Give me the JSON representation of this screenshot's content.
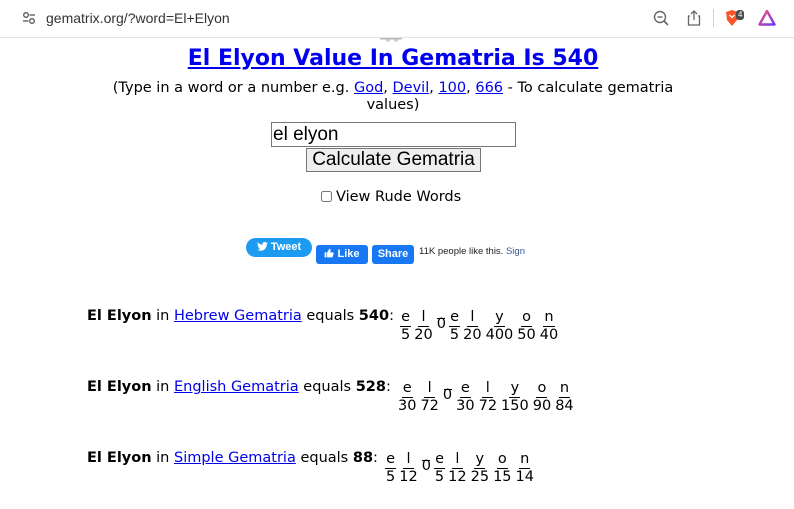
{
  "browser": {
    "url": "gematrix.org/?word=El+Elyon",
    "shield_count": "4"
  },
  "page": {
    "title": "El Elyon Value In Gematria Is 540",
    "intro": {
      "before": "(Type in a word or a number e.g. ",
      "links": [
        "God",
        "Devil",
        "100",
        "666"
      ],
      "after": " - To calculate gematria values)"
    },
    "input_value": "el elyon",
    "calculate_label": "Calculate Gematria",
    "rude_words_label": "View Rude Words",
    "rude_words_checked": false
  },
  "social": {
    "tweet_label": "Tweet",
    "like_label": "Like",
    "share_label": "Share",
    "like_count_text": "11K people like this.",
    "sign_label": "Sign"
  },
  "results": [
    {
      "word": "El Elyon",
      "in_text": "in",
      "system": "Hebrew Gematria",
      "equals_text": "equals",
      "total": "540",
      "letters": [
        {
          "ch": "e",
          "val": "5"
        },
        {
          "ch": "l",
          "val": "20"
        },
        {
          "ch": " ",
          "val": "0"
        },
        {
          "ch": "e",
          "val": "5"
        },
        {
          "ch": "l",
          "val": "20"
        },
        {
          "ch": "y",
          "val": "400"
        },
        {
          "ch": "o",
          "val": "50"
        },
        {
          "ch": "n",
          "val": "40"
        }
      ]
    },
    {
      "word": "El Elyon",
      "in_text": "in",
      "system": "English Gematria",
      "equals_text": "equals",
      "total": "528",
      "letters": [
        {
          "ch": "e",
          "val": "30"
        },
        {
          "ch": "l",
          "val": "72"
        },
        {
          "ch": " ",
          "val": "0"
        },
        {
          "ch": "e",
          "val": "30"
        },
        {
          "ch": "l",
          "val": "72"
        },
        {
          "ch": "y",
          "val": "150"
        },
        {
          "ch": "o",
          "val": "90"
        },
        {
          "ch": "n",
          "val": "84"
        }
      ]
    },
    {
      "word": "El Elyon",
      "in_text": "in",
      "system": "Simple Gematria",
      "equals_text": "equals",
      "total": "88",
      "letters": [
        {
          "ch": "e",
          "val": "5"
        },
        {
          "ch": "l",
          "val": "12"
        },
        {
          "ch": " ",
          "val": "0"
        },
        {
          "ch": "e",
          "val": "5"
        },
        {
          "ch": "l",
          "val": "12"
        },
        {
          "ch": "y",
          "val": "25"
        },
        {
          "ch": "o",
          "val": "15"
        },
        {
          "ch": "n",
          "val": "14"
        }
      ]
    }
  ],
  "colors": {
    "link": "#0000ee",
    "twitter": "#1d9bf0",
    "facebook": "#1877f2",
    "brave": "#fb542b"
  }
}
